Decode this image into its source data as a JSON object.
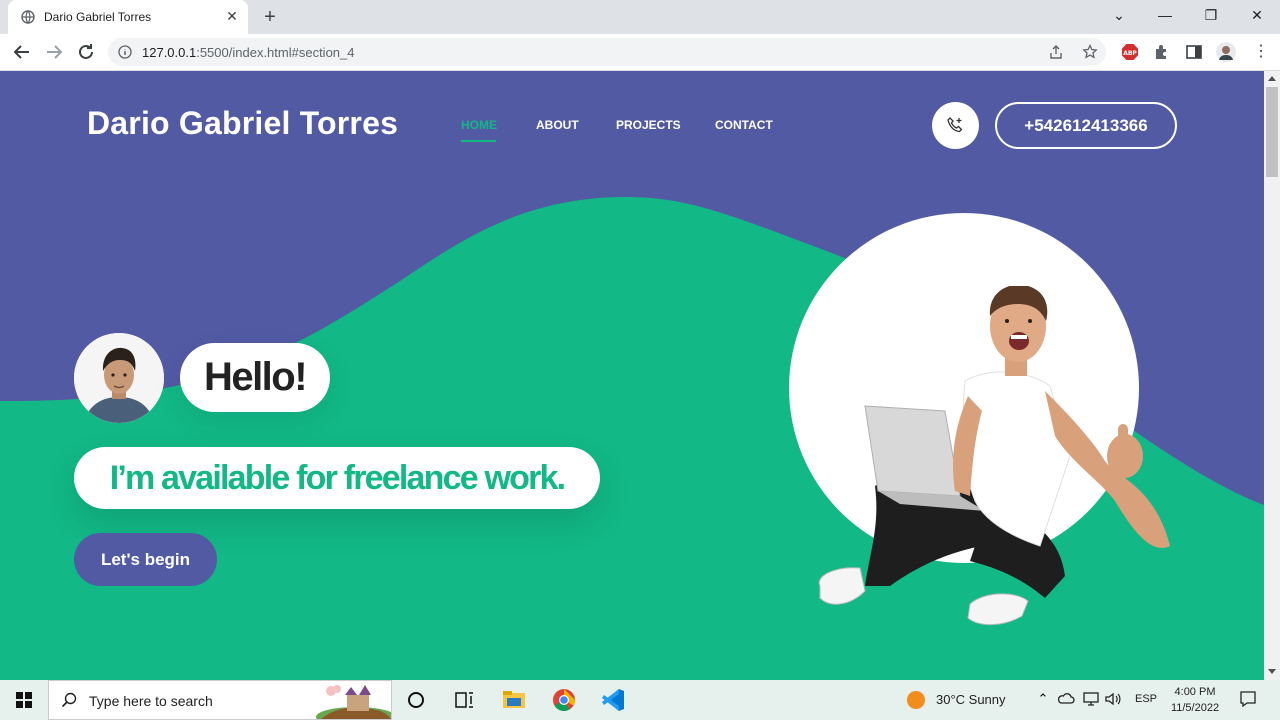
{
  "browser": {
    "tab_title": "Dario Gabriel Torres",
    "new_tab": "+",
    "url_host": "127.0.0.1",
    "url_rest": ":5500/index.html#section_4"
  },
  "site": {
    "brand": "Dario Gabriel Torres",
    "nav": [
      "HOME",
      "ABOUT",
      "PROJECTS",
      "CONTACT"
    ],
    "phone": "+542612413366",
    "hello": "Hello!",
    "tagline": "I’m available for freelance work.",
    "cta": "Let's begin"
  },
  "colors": {
    "primary_purple": "#525aa4",
    "accent_green": "#12b886",
    "white": "#ffffff"
  },
  "taskbar": {
    "search_placeholder": "Type here to search",
    "weather": "30°C  Sunny",
    "language": "ESP",
    "time": "4:00 PM",
    "date": "11/5/2022"
  }
}
